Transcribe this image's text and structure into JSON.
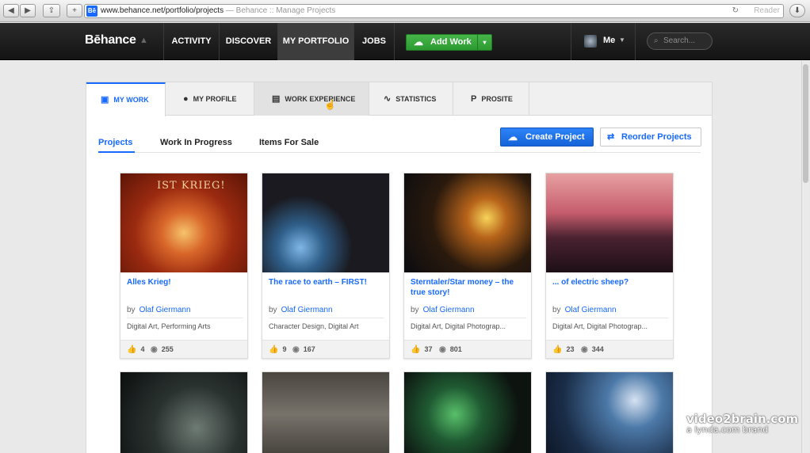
{
  "browser": {
    "url": "www.behance.net/portfolio/projects",
    "page_title": "Behance :: Manage Projects",
    "reader_label": "Reader",
    "back_icon": "back-arrow-icon",
    "forward_icon": "forward-arrow-icon"
  },
  "nav": {
    "brand": "Bēhance",
    "items": [
      "ACTIVITY",
      "DISCOVER",
      "MY PORTFOLIO",
      "JOBS"
    ],
    "add_work": "Add Work",
    "me_label": "Me",
    "search_placeholder": "Search..."
  },
  "portfolio_tabs": [
    "MY WORK",
    "MY PROFILE",
    "WORK EXPERIENCE",
    "STATISTICS",
    "PROSITE"
  ],
  "subtabs": [
    "Projects",
    "Work In Progress",
    "Items For Sale"
  ],
  "actions": {
    "create": "Create Project",
    "reorder": "Reorder Projects"
  },
  "projects": [
    {
      "title": "Alles Krieg!",
      "by": "by",
      "author": "Olaf Giermann",
      "fields": "Digital Art, Performing Arts",
      "appreciations": "4",
      "views": "255",
      "thumb_text": "IST KRIEG!"
    },
    {
      "title": "The race to earth – FIRST!",
      "by": "by",
      "author": "Olaf Giermann",
      "fields": "Character Design, Digital Art",
      "appreciations": "9",
      "views": "167"
    },
    {
      "title": "Sterntaler/Star money – the true story!",
      "by": "by",
      "author": "Olaf Giermann",
      "fields": "Digital Art, Digital Photograp...",
      "appreciations": "37",
      "views": "801"
    },
    {
      "title": "... of electric sheep?",
      "by": "by",
      "author": "Olaf Giermann",
      "fields": "Digital Art, Digital Photograp...",
      "appreciations": "23",
      "views": "344"
    }
  ],
  "watermark": {
    "line1": "video2brain.com",
    "line2": "a lynda.com brand"
  },
  "colors": {
    "accent": "#1769ff",
    "green": "#2b9a30",
    "nav_bg": "#1b1b1b"
  }
}
